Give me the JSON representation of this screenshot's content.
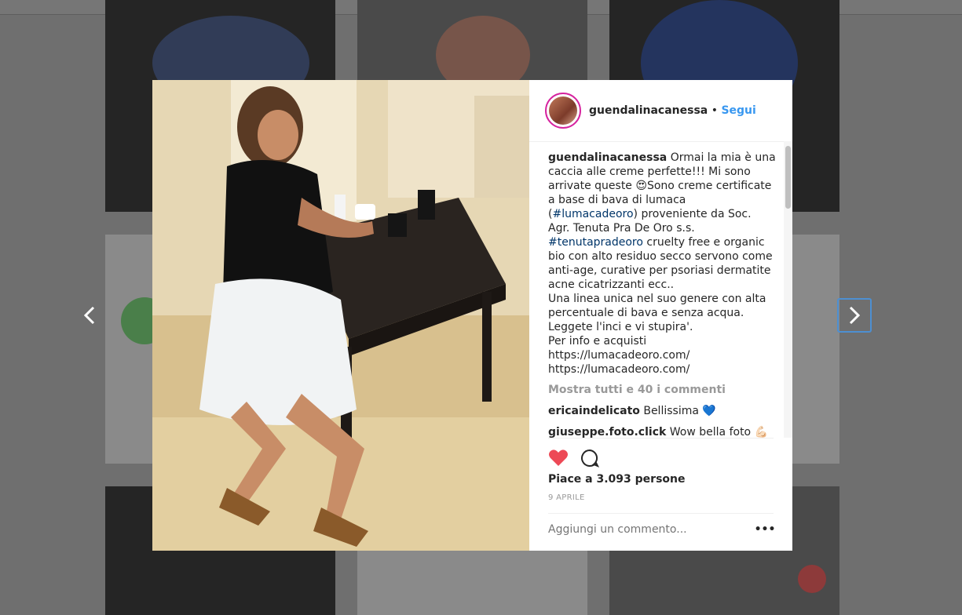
{
  "post": {
    "username": "guendalinacanessa",
    "separator": "•",
    "follow_label": "Segui",
    "caption_username": "guendalinacanessa",
    "caption_part1": " Ormai la mia è una caccia alle creme perfette!!! Mi sono arrivate queste 😍Sono creme certificate a base di bava di lumaca (",
    "hashtag1": "#lumacadeoro",
    "caption_part2": ") proveniente da Soc. Agr. Tenuta Pra De Oro s.s. ",
    "hashtag2": "#tenutapradeoro",
    "caption_part3": " cruelty free e organic bio con alto residuo secco servono come anti-age, curative per psoriasi dermatite acne cicatrizzanti ecc..\nUna linea unica nel suo genere con alta percentuale di bava e senza acqua.\nLeggete l'inci e vi stupira'.\nPer info e acquisti\nhttps://lumacadeoro.com/\nhttps://lumacadeoro.com/",
    "show_all_comments": "Mostra tutti e 40 i commenti",
    "comments": [
      {
        "user": "ericaindelicato",
        "text": " Bellissima 💙"
      },
      {
        "user": "giuseppe.foto.click",
        "text": " Wow bella foto 💪🏻◻"
      }
    ],
    "likes": "Piace a 3.093 persone",
    "date": "9 APRILE",
    "add_comment_placeholder": "Aggiungi un commento...",
    "more_label": "•••"
  },
  "icons": {
    "like": "heart-icon",
    "comment": "comment-bubble-icon",
    "prev": "chevron-left-icon",
    "next": "chevron-right-icon"
  },
  "colors": {
    "heart": "#ed4956",
    "link": "#3897f0",
    "hashtag": "#003569",
    "muted": "#999999",
    "avatar_ring": "#d6249f"
  }
}
